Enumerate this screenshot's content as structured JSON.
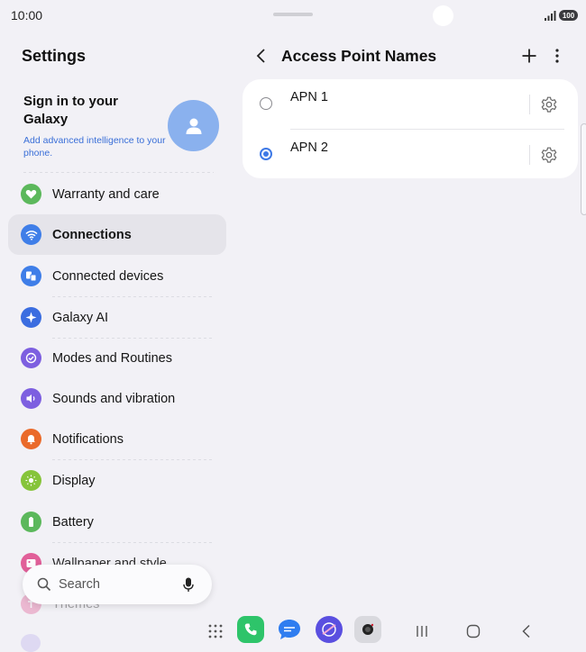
{
  "status_bar": {
    "time": "10:00",
    "battery": "100"
  },
  "left_panel": {
    "title": "Settings",
    "account": {
      "title": "Sign in to your Galaxy",
      "subtitle": "Add advanced intelligence to your phone.",
      "avatar_icon": "person-icon"
    },
    "items": [
      {
        "label": "Warranty and care",
        "icon": "heart-icon",
        "color": "#5cb85c"
      },
      {
        "label": "Connections",
        "icon": "wifi-icon",
        "color": "#3f7ee8",
        "active": true
      },
      {
        "label": "Connected devices",
        "icon": "devices-icon",
        "color": "#3f7ee8"
      },
      {
        "label": "Galaxy AI",
        "icon": "sparkle-icon",
        "color": "#3b6de0"
      },
      {
        "label": "Modes and Routines",
        "icon": "check-circle-icon",
        "color": "#7d5fe0"
      },
      {
        "label": "Sounds and vibration",
        "icon": "speaker-icon",
        "color": "#7d5fe0"
      },
      {
        "label": "Notifications",
        "icon": "bell-icon",
        "color": "#ea6a2a"
      },
      {
        "label": "Display",
        "icon": "sun-icon",
        "color": "#86c43a"
      },
      {
        "label": "Battery",
        "icon": "battery-icon",
        "color": "#5cb85c"
      },
      {
        "label": "Wallpaper and style",
        "icon": "image-icon",
        "color": "#e0508f"
      },
      {
        "label": "Themes",
        "icon": "themes-icon",
        "color": "#e0508f"
      }
    ],
    "search": {
      "label": "Search",
      "icon": "search-icon",
      "mic_icon": "mic-icon"
    }
  },
  "right_panel": {
    "title": "Access Point Names",
    "back_icon": "chevron-left-icon",
    "add_icon": "plus-icon",
    "more_icon": "more-vert-icon",
    "apns": [
      {
        "name": "APN 1",
        "selected": false
      },
      {
        "name": "APN 2",
        "selected": true
      }
    ]
  },
  "dock": {
    "apps": [
      "apps-grid-icon",
      "phone-icon",
      "messages-icon",
      "internet-icon",
      "camera-icon"
    ],
    "nav": [
      "recents-icon",
      "home-icon",
      "back-icon"
    ],
    "colors": {
      "phone": "#2ec46a",
      "messages": "#2f7df0",
      "internet": "#5a4fe0",
      "camera": "#d9d9de"
    }
  }
}
